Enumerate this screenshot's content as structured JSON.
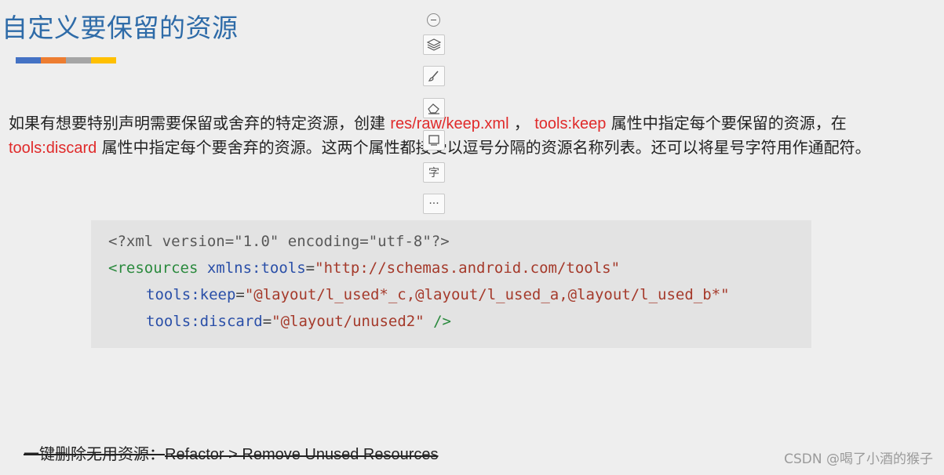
{
  "slide": {
    "title": "自定义要保留的资源",
    "underline_colors": [
      "#4472c4",
      "#ed7d31",
      "#a5a5a5",
      "#ffc000"
    ]
  },
  "paragraph": {
    "part1": "如果有想要特别声明需要保留或舍弃的特定资源，创建 ",
    "path": "res/raw/keep.xml",
    "part2": " ， ",
    "keep_attr": "tools:keep",
    "part3": " 属性中指定每个要保留的资源，在 ",
    "discard_attr": "tools:discard",
    "part4": " 属性中指定每个要舍弃的资源。这两个属性都接受以逗号分隔的资源名称列表。还可以将星号字符用作通配符。"
  },
  "code": {
    "line1": "<?xml version=\"1.0\" encoding=\"utf-8\"?>",
    "line2_tag": "<resources",
    "line2_attr": " xmlns:tools",
    "line2_eq": "=",
    "line2_val": "\"http://schemas.android.com/tools\"",
    "line3_attr": "tools:keep",
    "line3_eq": "=",
    "line3_val": "\"@layout/l_used*_c,@layout/l_used_a,@layout/l_used_b*\"",
    "line4_attr": "tools:discard",
    "line4_eq": "=",
    "line4_val": "\"@layout/unused2\"",
    "line4_close": " />"
  },
  "toolbar": {
    "icons": [
      "collapse-icon",
      "layers-icon",
      "brush-icon",
      "eraser-icon",
      "rectangle-icon",
      "text-icon",
      "more-icon"
    ],
    "text_glyph": "字",
    "more_glyph": "···"
  },
  "footer": {
    "prefix": "一键删除无用资源：",
    "menu_path": "Refactor > Remove Unused Resources"
  },
  "watermark": {
    "text": "CSDN @喝了小酒的猴子"
  },
  "colors": {
    "title": "#2e6ba8",
    "highlight": "#e02a2a",
    "background": "#eeeeee",
    "code_background": "#e3e3e3"
  }
}
